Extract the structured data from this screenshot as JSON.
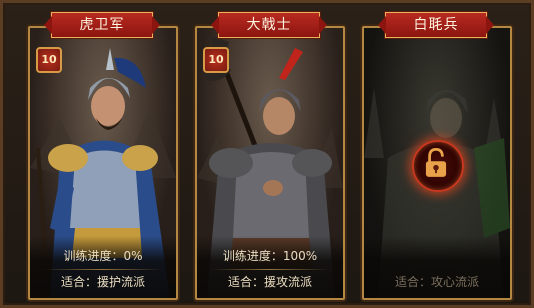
{
  "cards": [
    {
      "title": "虎卫军",
      "level": "10",
      "progress": "训练进度：0%",
      "suit": "适合：援护流派",
      "locked": false
    },
    {
      "title": "大戟士",
      "level": "10",
      "progress": "训练进度：100%",
      "suit": "适合：援攻流派",
      "locked": false
    },
    {
      "title": "白毦兵",
      "level": "",
      "progress": "",
      "suit": "适合：攻心流派",
      "locked": true
    }
  ],
  "colors": {
    "banner": "#b82a20",
    "gold_border": "#b48743",
    "lock_glow": "#c8381e"
  },
  "icons": {
    "lock": "padlock-icon"
  }
}
